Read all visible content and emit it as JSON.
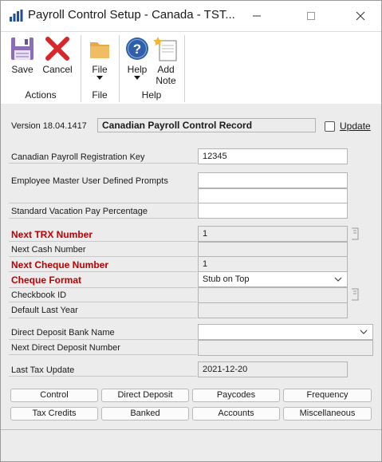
{
  "window": {
    "title": "Payroll Control Setup  -  Canada  -  TST..."
  },
  "ribbon": {
    "save_label": "Save",
    "cancel_label": "Cancel",
    "file_label": "File",
    "help_label": "Help",
    "add_note_label": "Add Note",
    "groups": {
      "actions": "Actions",
      "file": "File",
      "help": "Help"
    }
  },
  "header": {
    "version": "Version 18.04.1417",
    "record_title": "Canadian Payroll Control Record",
    "update_label": "Update",
    "update_checked": false
  },
  "form": {
    "registration_key_label": "Canadian Payroll Registration Key",
    "registration_key_value": "12345",
    "employee_prompts_label": "Employee Master User Defined Prompts",
    "employee_prompt_1": "",
    "employee_prompt_2": "",
    "vacation_pct_label": "Standard Vacation Pay Percentage",
    "vacation_pct_value": "",
    "next_trx_label": "Next TRX Number",
    "next_trx_value": "1",
    "next_cash_label": "Next Cash Number",
    "next_cash_value": "",
    "next_cheque_label": "Next Cheque Number",
    "next_cheque_value": "1",
    "cheque_format_label": "Cheque Format",
    "cheque_format_value": "Stub on Top",
    "checkbook_id_label": "Checkbook ID",
    "checkbook_id_value": "",
    "default_last_year_label": "Default Last Year",
    "default_last_year_value": "",
    "dd_bank_label": "Direct Deposit Bank Name",
    "dd_bank_value": "",
    "next_dd_label": "Next Direct Deposit Number",
    "next_dd_value": "",
    "last_tax_label": "Last Tax Update",
    "last_tax_value": "2021-12-20"
  },
  "buttons": {
    "row1": [
      "Control",
      "Direct Deposit",
      "Paycodes",
      "Frequency"
    ],
    "row2": [
      "Tax Credits",
      "Banked",
      "Accounts",
      "Miscellaneous"
    ]
  },
  "colors": {
    "required_label": "#c00000",
    "ribbon_icon_blue": "#2f5fa8",
    "cancel_red": "#d9262b",
    "folder": "#e6a94a"
  },
  "icons": [
    "app-icon",
    "minimize-icon",
    "maximize-icon",
    "close-icon",
    "save-icon",
    "cancel-icon",
    "folder-icon",
    "help-icon",
    "add-note-icon",
    "lookup-icon",
    "chevron-down-icon"
  ]
}
